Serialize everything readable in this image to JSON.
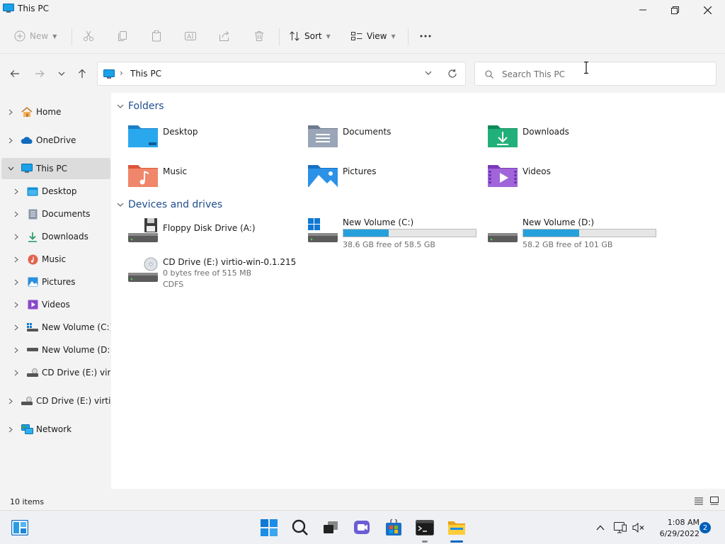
{
  "window": {
    "title": "This PC"
  },
  "toolbar": {
    "new_label": "New",
    "sort_label": "Sort",
    "view_label": "View"
  },
  "address": {
    "path": "This PC"
  },
  "search": {
    "placeholder": "Search This PC"
  },
  "nav_pane": {
    "items": [
      {
        "label": "Home",
        "icon": "home-icon"
      },
      {
        "label": "OneDrive",
        "icon": "cloud-icon"
      },
      {
        "label": "This PC",
        "icon": "pc-icon",
        "selected": true,
        "expanded": true
      },
      {
        "label": "Desktop",
        "icon": "desktop-folder-icon"
      },
      {
        "label": "Documents",
        "icon": "documents-folder-icon"
      },
      {
        "label": "Downloads",
        "icon": "download-icon"
      },
      {
        "label": "Music",
        "icon": "music-icon"
      },
      {
        "label": "Pictures",
        "icon": "pictures-icon"
      },
      {
        "label": "Videos",
        "icon": "videos-icon"
      },
      {
        "label": "New Volume (C:)",
        "icon": "windows-drive-icon"
      },
      {
        "label": "New Volume (D:)",
        "icon": "drive-icon"
      },
      {
        "label": "CD Drive (E:) virtio",
        "icon": "cd-drive-icon"
      },
      {
        "label": "CD Drive (E:) virtio-w",
        "icon": "cd-drive-icon"
      },
      {
        "label": "Network",
        "icon": "network-icon"
      }
    ]
  },
  "content": {
    "folders_heading": "Folders",
    "folders": [
      {
        "name": "Desktop",
        "icon": "desktop-folder-icon"
      },
      {
        "name": "Documents",
        "icon": "documents-folder-icon"
      },
      {
        "name": "Downloads",
        "icon": "downloads-folder-icon"
      },
      {
        "name": "Music",
        "icon": "music-folder-icon"
      },
      {
        "name": "Pictures",
        "icon": "pictures-folder-icon"
      },
      {
        "name": "Videos",
        "icon": "videos-folder-icon"
      }
    ],
    "devices_heading": "Devices and drives",
    "drives": [
      {
        "name": "Floppy Disk Drive (A:)",
        "icon": "floppy-drive-icon"
      },
      {
        "name": "New Volume (C:)",
        "free_text": "38.6 GB free of 58.5 GB",
        "used_fraction": 0.34,
        "icon": "windows-drive-icon"
      },
      {
        "name": "New Volume (D:)",
        "free_text": "58.2 GB free of 101 GB",
        "used_fraction": 0.42,
        "icon": "drive-icon"
      },
      {
        "name": "CD Drive (E:) virtio-win-0.1.215",
        "free_text": "0 bytes free of 515 MB",
        "fs": "CDFS",
        "icon": "cd-drive-icon"
      }
    ]
  },
  "status": {
    "item_count": "10 items"
  },
  "taskbar": {
    "clock_time": "1:08 AM",
    "clock_date": "6/29/2022",
    "notification_count": "2"
  },
  "colors": {
    "accent": "#0067c0",
    "progress": "#26a0da",
    "heading": "#1f4e8c"
  }
}
